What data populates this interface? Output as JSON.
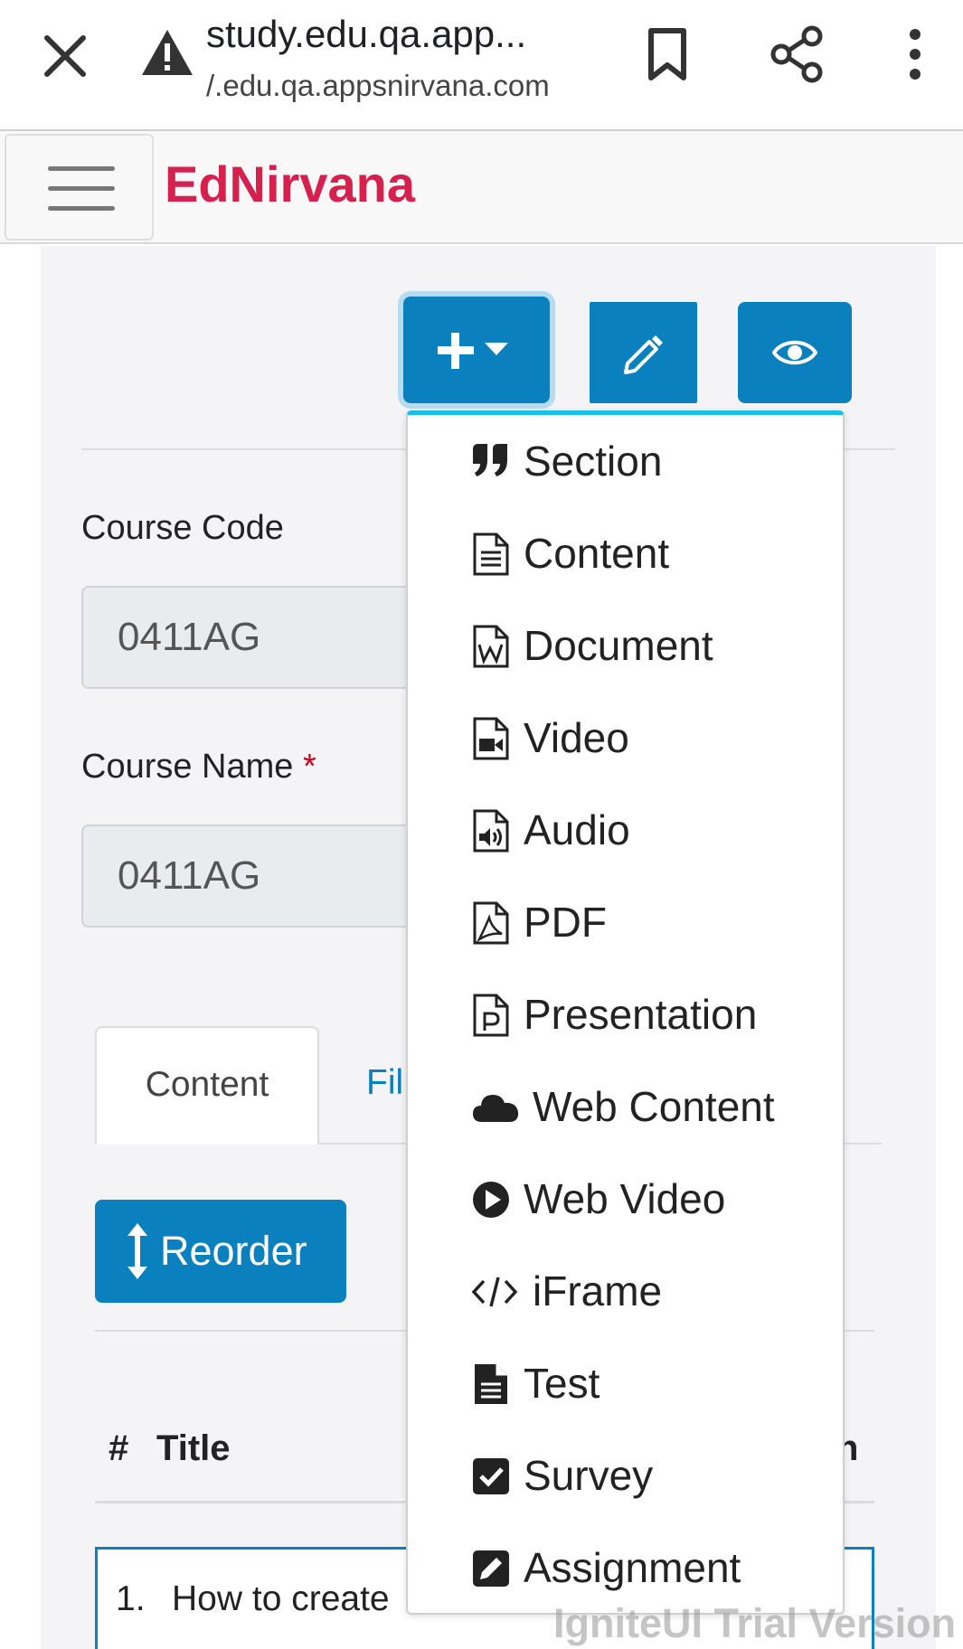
{
  "browser": {
    "url_title": "study.edu.qa.app...",
    "url_sub": "/.edu.qa.appsnirvana.com"
  },
  "app": {
    "brand": "EdNirvana"
  },
  "form": {
    "course_code_label": "Course Code",
    "course_code_value": "0411AG",
    "course_name_label": "Course Name",
    "course_name_required": "*",
    "course_name_value": "0411AG"
  },
  "tabs": {
    "active": "Content",
    "other": "Fil"
  },
  "reorder_label": "Reorder",
  "table": {
    "col_num": "#",
    "col_title": "Title",
    "col_partial": "n",
    "rows": [
      {
        "num": "1.",
        "title": "How to create"
      }
    ]
  },
  "dropdown": {
    "items": [
      {
        "label": "Section",
        "icon": "quote-icon"
      },
      {
        "label": "Content",
        "icon": "file-text-icon"
      },
      {
        "label": "Document",
        "icon": "file-word-icon"
      },
      {
        "label": "Video",
        "icon": "file-video-icon"
      },
      {
        "label": "Audio",
        "icon": "file-audio-icon"
      },
      {
        "label": "PDF",
        "icon": "file-pdf-icon"
      },
      {
        "label": "Presentation",
        "icon": "file-powerpoint-icon"
      },
      {
        "label": "Web Content",
        "icon": "cloud-icon"
      },
      {
        "label": "Web Video",
        "icon": "play-circle-icon"
      },
      {
        "label": "iFrame",
        "icon": "code-icon"
      },
      {
        "label": "Test",
        "icon": "file-alt-icon"
      },
      {
        "label": "Survey",
        "icon": "check-square-icon"
      },
      {
        "label": "Assignment",
        "icon": "edit-square-icon"
      }
    ]
  },
  "watermark": "IgniteUI Trial Version",
  "colors": {
    "brand": "#d6204e",
    "primary": "#0a80bf",
    "dropdown_accent": "#19c1ea",
    "required": "#d0021b"
  }
}
